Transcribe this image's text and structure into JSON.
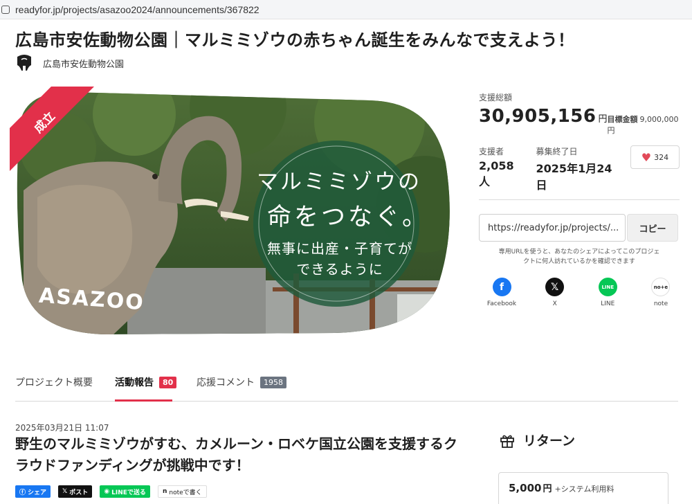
{
  "browser": {
    "url": "readyfor.jp/projects/asazoo2024/announcements/367822"
  },
  "project": {
    "title": "広島市安佐動物公園｜マルミミゾウの赤ちゃん誕生をみんなで支えよう！",
    "owner_name": "広島市安佐動物公園"
  },
  "hero": {
    "badge": "成立",
    "headline_line1": "マルミミゾウの",
    "headline_line2": "命をつなぐ。",
    "sub_line1": "無事に出産・子育てが",
    "sub_line2": "できるように",
    "logo_text": "ASAZOO"
  },
  "funding": {
    "total_label": "支援総額",
    "total_value": "30,905,156",
    "total_unit": "円",
    "goal_label": "目標金額",
    "goal_value": "9,000,000円",
    "supporters_label": "支援者",
    "supporters_value": "2,058人",
    "end_label": "募集終了日",
    "end_value": "2025年1月24日",
    "likes": "324"
  },
  "share": {
    "url": "https://readyfor.jp/projects/...",
    "copy_label": "コピー",
    "note_line1": "専用URLを使うと、あなたのシェアによってこのプロジェ",
    "note_line2": "クトに何人訪れているかを確認できます",
    "sns": [
      {
        "label": "Facebook",
        "glyph": "f",
        "color": "#1877f2"
      },
      {
        "label": "X",
        "glyph": "𝕏",
        "color": "#111111"
      },
      {
        "label": "LINE",
        "glyph": "LINE",
        "color": "#06c755"
      },
      {
        "label": "note",
        "glyph": "no+e",
        "color": "#ffffff"
      }
    ]
  },
  "tabs": [
    {
      "label": "プロジェクト概要",
      "count": ""
    },
    {
      "label": "活動報告",
      "count": "80",
      "count_color": "#e2304a"
    },
    {
      "label": "応援コメント",
      "count": "1958",
      "count_color": "#6b7480"
    }
  ],
  "post": {
    "date": "2025年03月21日 11:07",
    "title": "野生のマルミミゾウがすむ、カメルーン・ロベケ国立公園を支援するクラウドファンディングが挑戦中です！",
    "share_buttons": [
      {
        "label": "シェア",
        "color": "#1877f2"
      },
      {
        "label": "ポスト",
        "color": "#111111"
      },
      {
        "label": "LINEで送る",
        "color": "#06c755"
      },
      {
        "label": "noteで書く",
        "color": "#ffffff"
      }
    ]
  },
  "returns": {
    "heading": "リターン",
    "first_price": "5,000",
    "first_price_unit": "円",
    "first_price_note": "+システム利用料"
  }
}
